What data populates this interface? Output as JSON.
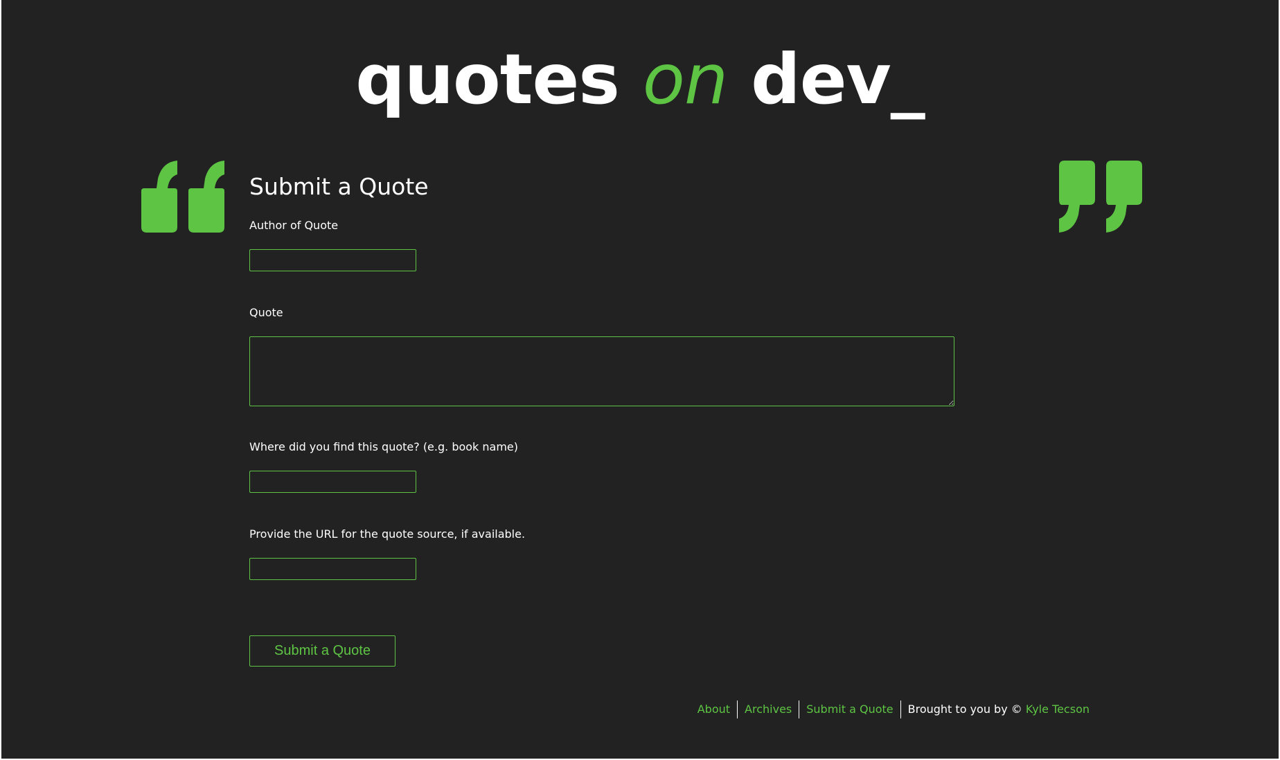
{
  "header": {
    "logo_part1": "quotes",
    "logo_part2": "on",
    "logo_part3": "dev_"
  },
  "decor": {
    "open_quote_icon": "open-quote-icon",
    "close_quote_icon": "close-quote-icon"
  },
  "form": {
    "title": "Submit a Quote",
    "author_label": "Author of Quote",
    "author_value": "",
    "quote_label": "Quote",
    "quote_value": "",
    "source_label": "Where did you find this quote? (e.g. book name)",
    "source_value": "",
    "url_label": "Provide the URL for the quote source, if available.",
    "url_value": "",
    "submit_label": "Submit a Quote"
  },
  "footer": {
    "links": [
      "About",
      "Archives",
      "Submit a Quote"
    ],
    "credit_text": "Brought to you by ©",
    "author_link": "Kyle Tecson"
  },
  "colors": {
    "background": "#222222",
    "accent": "#5ec544",
    "text": "#ffffff"
  }
}
